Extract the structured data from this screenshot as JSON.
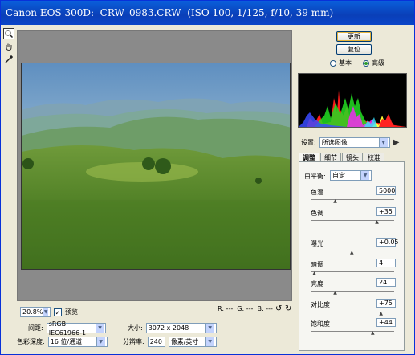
{
  "window": {
    "title": "Canon EOS 300D:  CRW_0983.CRW  (ISO 100, 1/125, f/10, 39 mm)"
  },
  "tools": [
    {
      "name": "zoom-icon",
      "glyph": "🔍"
    },
    {
      "name": "hand-icon",
      "glyph": "✋"
    },
    {
      "name": "eyedropper-icon",
      "glyph": "✎"
    }
  ],
  "preview": {
    "zoom_value": "20.8%",
    "preview_label": "预览",
    "preview_checked": true,
    "rgb_readout": "R: ---  G: ---  B: ---"
  },
  "bottom": {
    "space_label": "间距:",
    "space_value": "sRGB IEC61966-1",
    "depth_label": "色彩深度:",
    "depth_value": "16 位/通道",
    "size_label": "大小:",
    "size_value": "3072 x 2048",
    "res_label": "分辨率:",
    "res_value": "240",
    "res_unit": "像素/英寸"
  },
  "buttons": {
    "ok": "更新",
    "reset": "复位"
  },
  "mode": {
    "basic": "基本",
    "advanced": "高级",
    "selected": "advanced"
  },
  "settings": {
    "label": "设置:",
    "value": "所选图像"
  },
  "tabs": [
    "调整",
    "细节",
    "镜头",
    "校准"
  ],
  "adjust": {
    "wb_label": "白平衡:",
    "wb_value": "自定",
    "sliders": [
      {
        "label": "色温",
        "value": "5000",
        "level": 0.3
      },
      {
        "label": "色调",
        "value": "+35",
        "level": 0.8
      },
      {
        "label": "曝光",
        "value": "+0.05",
        "level": 0.5
      },
      {
        "label": "暗调",
        "value": "4",
        "level": 0.05
      },
      {
        "label": "亮度",
        "value": "24",
        "level": 0.3
      },
      {
        "label": "对比度",
        "value": "+75",
        "level": 0.85
      },
      {
        "label": "饱和度",
        "value": "+44",
        "level": 0.75
      }
    ]
  },
  "colors": {
    "title_bar": "#0a4fd0",
    "accent": "#e5b43c"
  }
}
